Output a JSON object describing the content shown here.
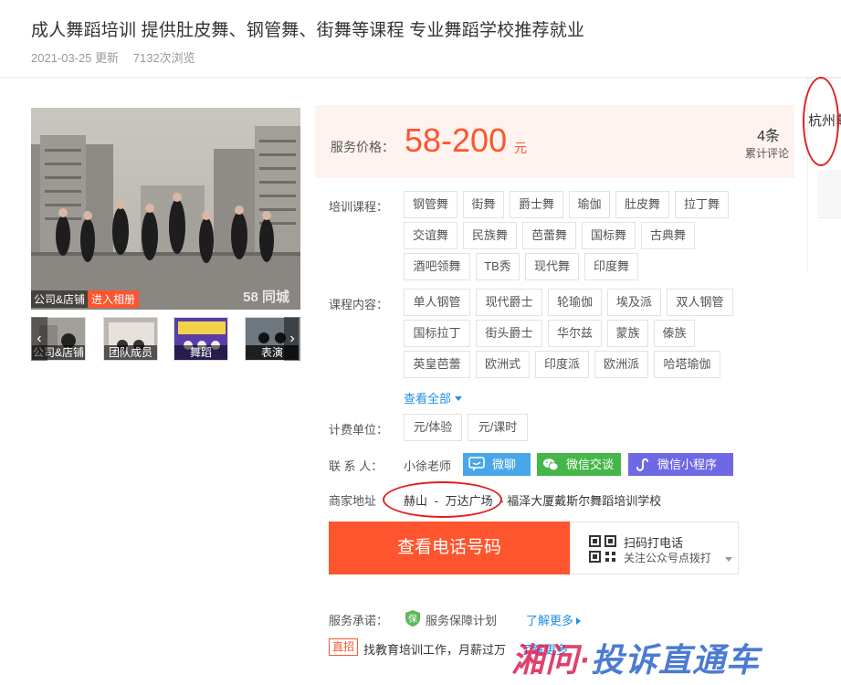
{
  "header": {
    "title": "成人舞蹈培训 提供肚皮舞、钢管舞、街舞等课程 专业舞蹈学校推荐就业",
    "date": "2021-03-25 更新",
    "views": "7132次浏览"
  },
  "gallery": {
    "main_label": "公司&店铺",
    "album_link": "进入相册",
    "watermark": "58 同城",
    "thumbs": [
      "公司&店铺",
      "团队成员",
      "舞蹈",
      "表演"
    ],
    "prev_arrow": "‹",
    "next_arrow": "›"
  },
  "price": {
    "label": "服务价格：",
    "value": "58-200",
    "unit": "元",
    "review_count": "4条",
    "review_label": "累计评论"
  },
  "training": {
    "label": "培训课程：",
    "tags": [
      "钢管舞",
      "街舞",
      "爵士舞",
      "瑜伽",
      "肚皮舞",
      "拉丁舞",
      "交谊舞",
      "民族舞",
      "芭蕾舞",
      "国标舞",
      "古典舞",
      "酒吧领舞",
      "TB秀",
      "现代舞",
      "印度舞"
    ]
  },
  "content": {
    "label": "课程内容：",
    "tags": [
      "单人钢管",
      "现代爵士",
      "轮瑜伽",
      "埃及派",
      "双人钢管",
      "国标拉丁",
      "街头爵士",
      "华尔兹",
      "蒙族",
      "傣族",
      "英皇芭蕾",
      "欧洲式",
      "印度派",
      "欧洲派",
      "哈塔瑜伽"
    ],
    "more_link": "查看全部"
  },
  "billing": {
    "label": "计费单位：",
    "tags": [
      "元/体验",
      "元/课时"
    ]
  },
  "contact": {
    "label": "联 系 人：",
    "name": "小徐老师",
    "chat": "微聊",
    "wechat": "微信交谈",
    "mini_program": "微信小程序"
  },
  "address": {
    "label": "商家地址",
    "district": "赫山",
    "sep1": "-",
    "area": "万达广场",
    "rest": "- 福泽大厦戴斯尔舞蹈培训学校"
  },
  "actions": {
    "call_button": "查看电话号码",
    "qr_title": "扫码打电话",
    "qr_sub": "关注公众号点拨打"
  },
  "promise": {
    "label": "服务承诺：",
    "badge": "保",
    "text": "服务保障计划",
    "link": "了解更多"
  },
  "job": {
    "badge": "直招",
    "text": "找教育培训工作，月薪过万",
    "link": "了解更多"
  },
  "overlay_watermark": {
    "part1": "湘问·",
    "part2": "投诉直通车"
  },
  "side": {
    "city": "杭州戴"
  },
  "colors": {
    "accent": "#ff552e",
    "link": "#1f8fe6",
    "price_bg": "#fff3ef",
    "annotation": "#e02020"
  }
}
